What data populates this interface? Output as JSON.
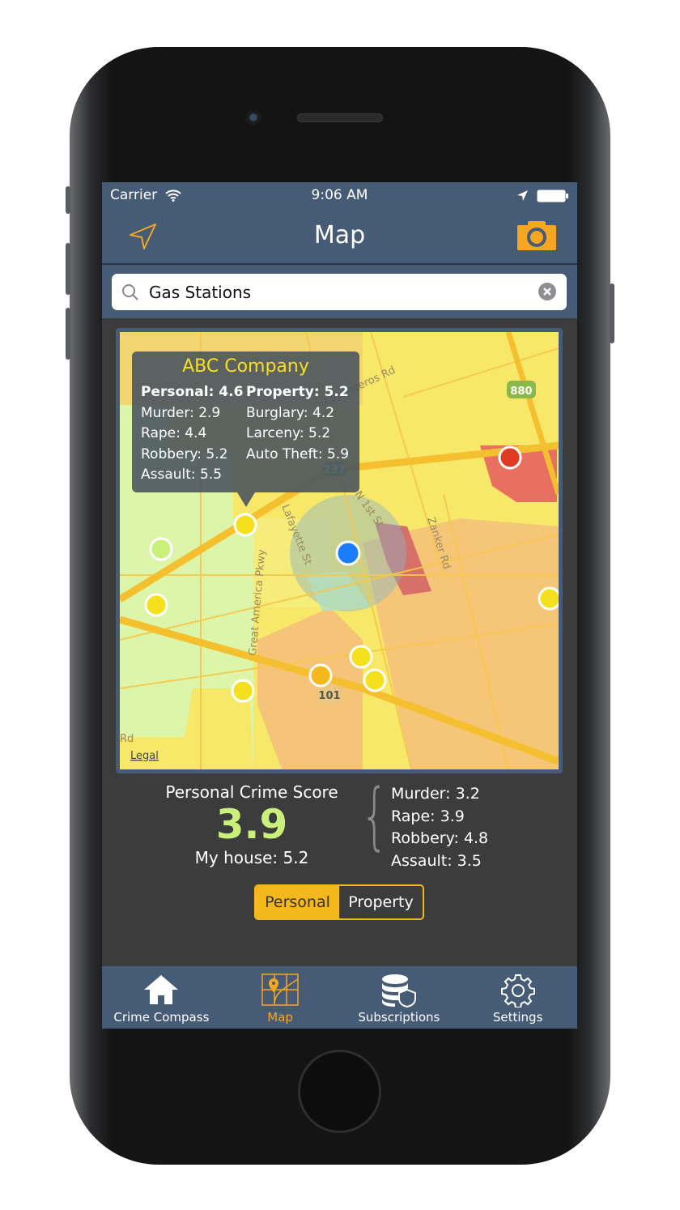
{
  "status_bar": {
    "carrier": "Carrier",
    "time": "9:06 AM"
  },
  "nav": {
    "title": "Map",
    "left_icon": "location-arrow-icon",
    "right_icon": "camera-icon"
  },
  "search": {
    "value": "Gas Stations",
    "icon": "search-icon",
    "clear_icon": "clear-icon"
  },
  "map": {
    "road_labels": [
      "Los Esteros Rd",
      "880",
      "237",
      "N 1st St",
      "Lafayette St",
      "Zanker Rd",
      "Great America Pkwy",
      "101",
      "Rd"
    ],
    "legal": "Legal",
    "callout": {
      "title": "ABC Company",
      "left": {
        "header": "Personal: 4.6",
        "rows": [
          "Murder: 2.9",
          "Rape: 4.4",
          "Robbery: 5.2",
          "Assault: 5.5"
        ]
      },
      "right": {
        "header": "Property: 5.2",
        "rows": [
          "Burglary: 4.2",
          "Larceny: 5.2",
          "Auto Theft: 5.9"
        ]
      }
    },
    "colors": {
      "low": "#c8f07a",
      "medium": "#f5e01e",
      "high": "#f5b81c",
      "very_high": "#e03a22",
      "user": "#1a7cff"
    }
  },
  "score": {
    "title": "Personal Crime Score",
    "value": "3.9",
    "house": "My house: 5.2",
    "breakdown": [
      "Murder: 3.2",
      "Rape: 3.9",
      "Robbery: 4.8",
      "Assault: 3.5"
    ]
  },
  "segment": {
    "options": [
      "Personal",
      "Property"
    ],
    "selected": "Personal"
  },
  "tabs": [
    {
      "label": "Crime Compass",
      "icon": "home-icon",
      "active": false
    },
    {
      "label": "Map",
      "icon": "map-icon",
      "active": true
    },
    {
      "label": "Subscriptions",
      "icon": "database-shield-icon",
      "active": false
    },
    {
      "label": "Settings",
      "icon": "gear-icon",
      "active": false
    }
  ],
  "accent": "#f5a623"
}
